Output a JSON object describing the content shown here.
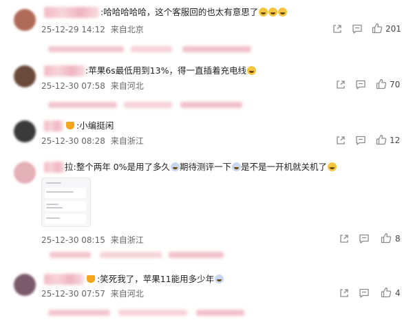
{
  "comments": [
    {
      "text": ":哈哈哈哈哈，这个客服回的也太有意思了",
      "date": "25-12-29 14:12",
      "location": "来自北京",
      "likes": "201",
      "avatar_color": "#b06a5a"
    },
    {
      "text": ":苹果6s最低用到13%，得一直插着充电线",
      "date": "25-12-30 07:58",
      "location": "来自河北",
      "likes": "70",
      "avatar_color": "#6a4a3a"
    },
    {
      "text": ":小编挺闲",
      "date": "25-12-30 08:28",
      "location": "来自浙江",
      "likes": "12",
      "avatar_color": "#3a3a3a"
    },
    {
      "text_a": "拉:整个两年 0%是用了多久",
      "text_b": "期待测评一下",
      "text_c": "是不是一开机就关机了",
      "date": "25-12-30 08:15",
      "location": "来自浙江",
      "likes": "8",
      "avatar_color": "#e4b0b8"
    },
    {
      "text": ":笑死我了，苹果11能用多少年",
      "date": "25-12-30 07:57",
      "location": "来自河北",
      "likes": "4",
      "avatar_color": "#7a5a6a"
    }
  ],
  "colors": {
    "meta": "#666666",
    "icon": "#8a8a8a",
    "blur_pink": "#f3b8c4"
  },
  "icons": [
    "share-icon",
    "comment-icon",
    "like-icon"
  ]
}
